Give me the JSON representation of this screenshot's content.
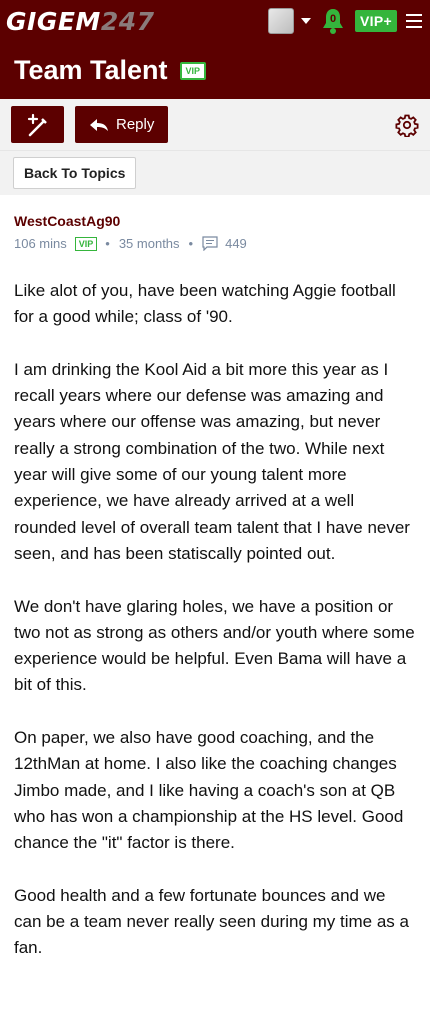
{
  "header": {
    "logo_main": "GIGEM",
    "logo_num": "247",
    "notifications_count": "0",
    "vip_label": "VIP+"
  },
  "titlebar": {
    "title": "Team Talent",
    "badge": "VIP"
  },
  "actions": {
    "reply_label": "Reply",
    "back_label": "Back To Topics"
  },
  "post": {
    "author": "WestCoastAg90",
    "time_ago": "106 mins",
    "badge": "VIP",
    "member_age": "35 months",
    "post_count": "449",
    "paragraphs": [
      "Like alot of you, have been watching Aggie football for a good while; class of '90.",
      "I am drinking the Kool Aid a bit more this year as I recall years where our defense was amazing and years where our offense was amazing, but never really a strong combination of the two. While next year will give some of our young talent more experience, we have already arrived at a well rounded level of overall team talent that I have never seen, and has been statiscally pointed out.",
      "We don't have glaring holes, we have a position or two not as strong as others and/or youth where some experience would be helpful. Even Bama will have a bit of this.",
      "On paper, we also have good coaching, and the 12thMan at home. I also like the coaching changes Jimbo made, and I like having a coach's son at QB who has won a championship at the HS level. Good chance the \"it\" factor is there.",
      "Good health and a few fortunate bounces and we can be a team never really seen during my time as a fan."
    ]
  },
  "colors": {
    "maroon": "#5c0000",
    "green": "#35b53c",
    "meta": "#7a8aa0"
  }
}
